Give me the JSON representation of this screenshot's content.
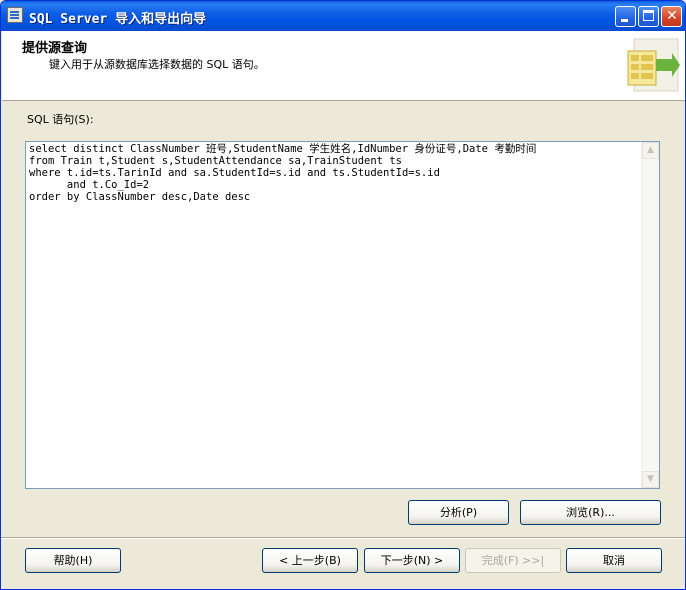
{
  "window": {
    "title": "SQL Server 导入和导出向导"
  },
  "header": {
    "title": "提供源查询",
    "subtitle": "键入用于从源数据库选择数据的 SQL 语句。",
    "graphic_icon": "wizard-table-graphic-icon"
  },
  "sql": {
    "label": "SQL 语句(S):",
    "text": "select distinct ClassNumber 班号,StudentName 学生姓名,IdNumber 身份证号,Date 考勤时间\nfrom Train t,Student s,StudentAttendance sa,TrainStudent ts\nwhere t.id=ts.TarinId and sa.StudentId=s.id and ts.StudentId=s.id\n      and t.Co_Id=2\norder by ClassNumber desc,Date desc"
  },
  "buttons": {
    "parse": "分析(P)",
    "browse": "浏览(R)...",
    "help": "帮助(H)",
    "back": "< 上一步(B)",
    "next": "下一步(N) >",
    "finish": "完成(F) >>|",
    "cancel": "取消"
  },
  "colors": {
    "titlebar": "#0054e3",
    "dialog_bg": "#ece9d8",
    "editor_border": "#7f9db9"
  }
}
